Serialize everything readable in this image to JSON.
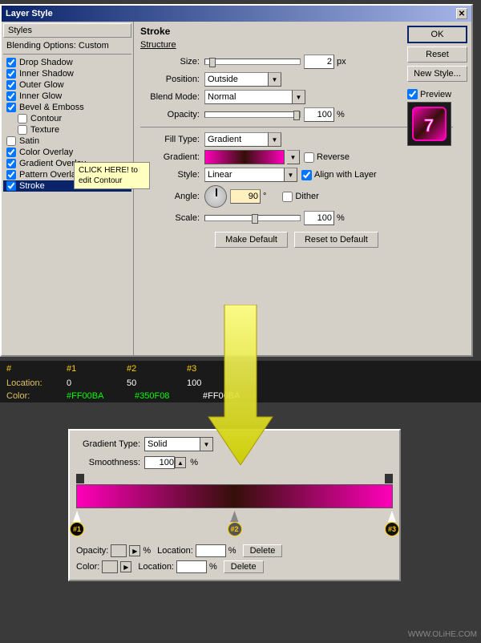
{
  "dialog": {
    "title": "Layer Style",
    "close_label": "✕"
  },
  "styles_panel": {
    "header_label": "Styles",
    "blending_label": "Blending Options: Custom",
    "items": [
      {
        "id": "drop-shadow",
        "label": "Drop Shadow",
        "checked": true
      },
      {
        "id": "inner-shadow",
        "label": "Inner Shadow",
        "checked": true
      },
      {
        "id": "outer-glow",
        "label": "Outer Glow",
        "checked": true
      },
      {
        "id": "inner-glow",
        "label": "Inner Glow",
        "checked": true
      },
      {
        "id": "bevel-emboss",
        "label": "Bevel & Emboss",
        "checked": true
      },
      {
        "id": "contour",
        "label": "Contour",
        "checked": false
      },
      {
        "id": "texture",
        "label": "Texture",
        "checked": false
      },
      {
        "id": "satin",
        "label": "Satin",
        "checked": false
      },
      {
        "id": "color-overlay",
        "label": "Color Overlay",
        "checked": true
      },
      {
        "id": "gradient-overlay",
        "label": "Gradient Overlay",
        "checked": true
      },
      {
        "id": "pattern-overlay",
        "label": "Pattern Overlay",
        "checked": true
      },
      {
        "id": "stroke",
        "label": "Stroke",
        "checked": true,
        "active": true
      }
    ]
  },
  "tooltip": {
    "text": "CLICK HERE!\nto edit Contour"
  },
  "stroke_section": {
    "title": "Stroke",
    "structure_label": "Structure",
    "size_label": "Size:",
    "size_value": "2",
    "size_unit": "px",
    "position_label": "Position:",
    "position_value": "Outside",
    "blend_mode_label": "Blend Mode:",
    "blend_mode_value": "Normal",
    "opacity_label": "Opacity:",
    "opacity_value": "100",
    "opacity_unit": "%",
    "fill_type_label": "Fill Type:",
    "fill_type_value": "Gradient",
    "gradient_label": "Gradient:",
    "reverse_label": "Reverse",
    "style_label": "Style:",
    "style_value": "Linear",
    "align_layer_label": "Align with Layer",
    "angle_label": "Angle:",
    "angle_value": "90",
    "angle_unit": "°",
    "dither_label": "Dither",
    "scale_label": "Scale:",
    "scale_value": "100",
    "scale_unit": "%",
    "make_default_btn": "Make Default",
    "reset_default_btn": "Reset to Default"
  },
  "right_buttons": {
    "ok": "OK",
    "reset": "Reset",
    "new_style": "New Style...",
    "preview_label": "Preview"
  },
  "gradient_stops": {
    "headers": [
      "#",
      "#1",
      "#2",
      "#3"
    ],
    "location_row_label": "Location:",
    "location_values": [
      "0",
      "50",
      "100"
    ],
    "color_row_label": "Color:",
    "color_values": [
      "#FF00BA",
      "#350F08",
      "#FF00BA"
    ]
  },
  "gradient_editor": {
    "type_label": "Gradient Type:",
    "type_value": "Solid",
    "smoothness_label": "Smoothness:",
    "smoothness_value": "100",
    "smoothness_unit": "%",
    "stops": [
      {
        "id": "#1",
        "position": 0,
        "color": "#FF00BA",
        "type": "color"
      },
      {
        "id": "#2",
        "position": 50,
        "color": "#350F08",
        "type": "color"
      },
      {
        "id": "#3",
        "position": 100,
        "color": "#FF00BA",
        "type": "color"
      }
    ],
    "opacity_label": "Opacity:",
    "opacity_unit": "%",
    "location_label": "Location:",
    "location_unit": "%",
    "delete_btn": "Delete",
    "color_label": "Color:",
    "color_location_label": "Location:",
    "color_location_unit": "%",
    "color_delete_btn": "Delete"
  },
  "watermark": "WWW.OLiHE.COM"
}
